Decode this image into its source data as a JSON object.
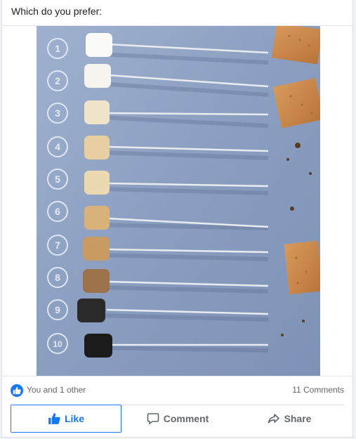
{
  "post": {
    "caption": "Which do you prefer:",
    "photo": {
      "alt": "",
      "step_numbers": [
        "1",
        "2",
        "3",
        "4",
        "5",
        "6",
        "7",
        "8",
        "9",
        "10"
      ],
      "colors": {
        "background": "#8fa2c2",
        "marshmallow_levels": [
          "#fbfbfa",
          "#f6f4ee",
          "#efe3c9",
          "#e8cfa2",
          "#ecd9b2",
          "#d9b27a",
          "#c89b63",
          "#9b7249",
          "#2b2a2a",
          "#1c1b1c"
        ]
      }
    },
    "stats": {
      "reactions_text": "You and 1 other",
      "comments_text": "11 Comments",
      "accent_color": "#1877f2"
    },
    "actions": {
      "like_label": "Like",
      "comment_label": "Comment",
      "share_label": "Share"
    }
  }
}
